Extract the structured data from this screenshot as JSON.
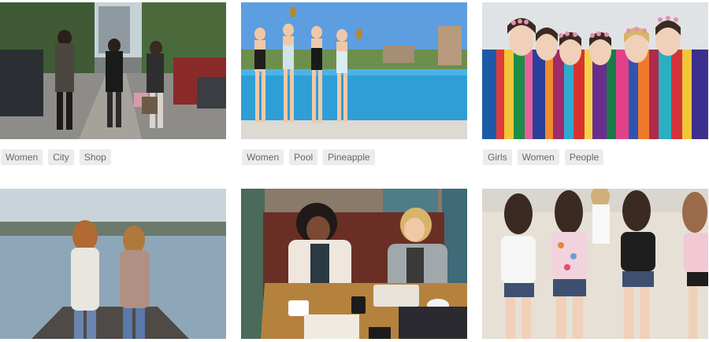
{
  "gallery": {
    "items": [
      {
        "name": "women-city-shop",
        "tags": [
          "Women",
          "City",
          "Shop"
        ]
      },
      {
        "name": "women-pool-pineapple",
        "tags": [
          "Women",
          "Pool",
          "Pineapple"
        ]
      },
      {
        "name": "girls-women-people",
        "tags": [
          "Girls",
          "Women",
          "People"
        ]
      },
      {
        "name": "women-pier",
        "tags": []
      },
      {
        "name": "women-cafe",
        "tags": []
      },
      {
        "name": "girls-beach",
        "tags": []
      }
    ]
  }
}
